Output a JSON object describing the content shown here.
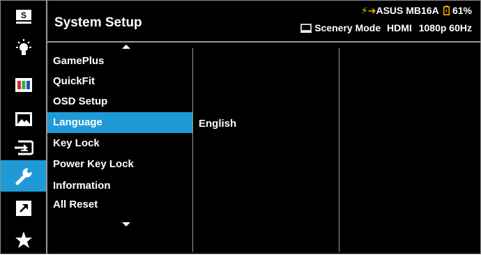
{
  "header": {
    "title": "System Setup",
    "charging_symbol": "⚡➔",
    "model": "ASUS MB16A",
    "battery_icon": "battery-icon",
    "battery_level": "61%",
    "monitor_icon": "monitor-icon",
    "mode": "Scenery Mode",
    "input": "HDMI",
    "resolution": "1080p 60Hz"
  },
  "sidebar": {
    "icons": [
      {
        "name": "splendid-icon",
        "label": "S"
      },
      {
        "name": "blue-light-filter-icon"
      },
      {
        "name": "color-icon"
      },
      {
        "name": "image-icon"
      },
      {
        "name": "input-select-icon"
      },
      {
        "name": "system-setup-icon",
        "active": true
      },
      {
        "name": "shortcut-icon"
      },
      {
        "name": "myfavorite-star-icon"
      }
    ]
  },
  "menu": {
    "items": [
      {
        "label": "GamePlus"
      },
      {
        "label": "QuickFit"
      },
      {
        "label": "OSD Setup"
      },
      {
        "label": "Language",
        "selected": true
      },
      {
        "label": "Key Lock"
      },
      {
        "label": "Power Key Lock"
      },
      {
        "label": "Information"
      },
      {
        "label": "All Reset"
      }
    ],
    "submenu_value": "English"
  },
  "colors": {
    "highlight": "#1f9ad6",
    "background": "#000000",
    "text": "#ffffff",
    "battery": "#f5b800"
  }
}
